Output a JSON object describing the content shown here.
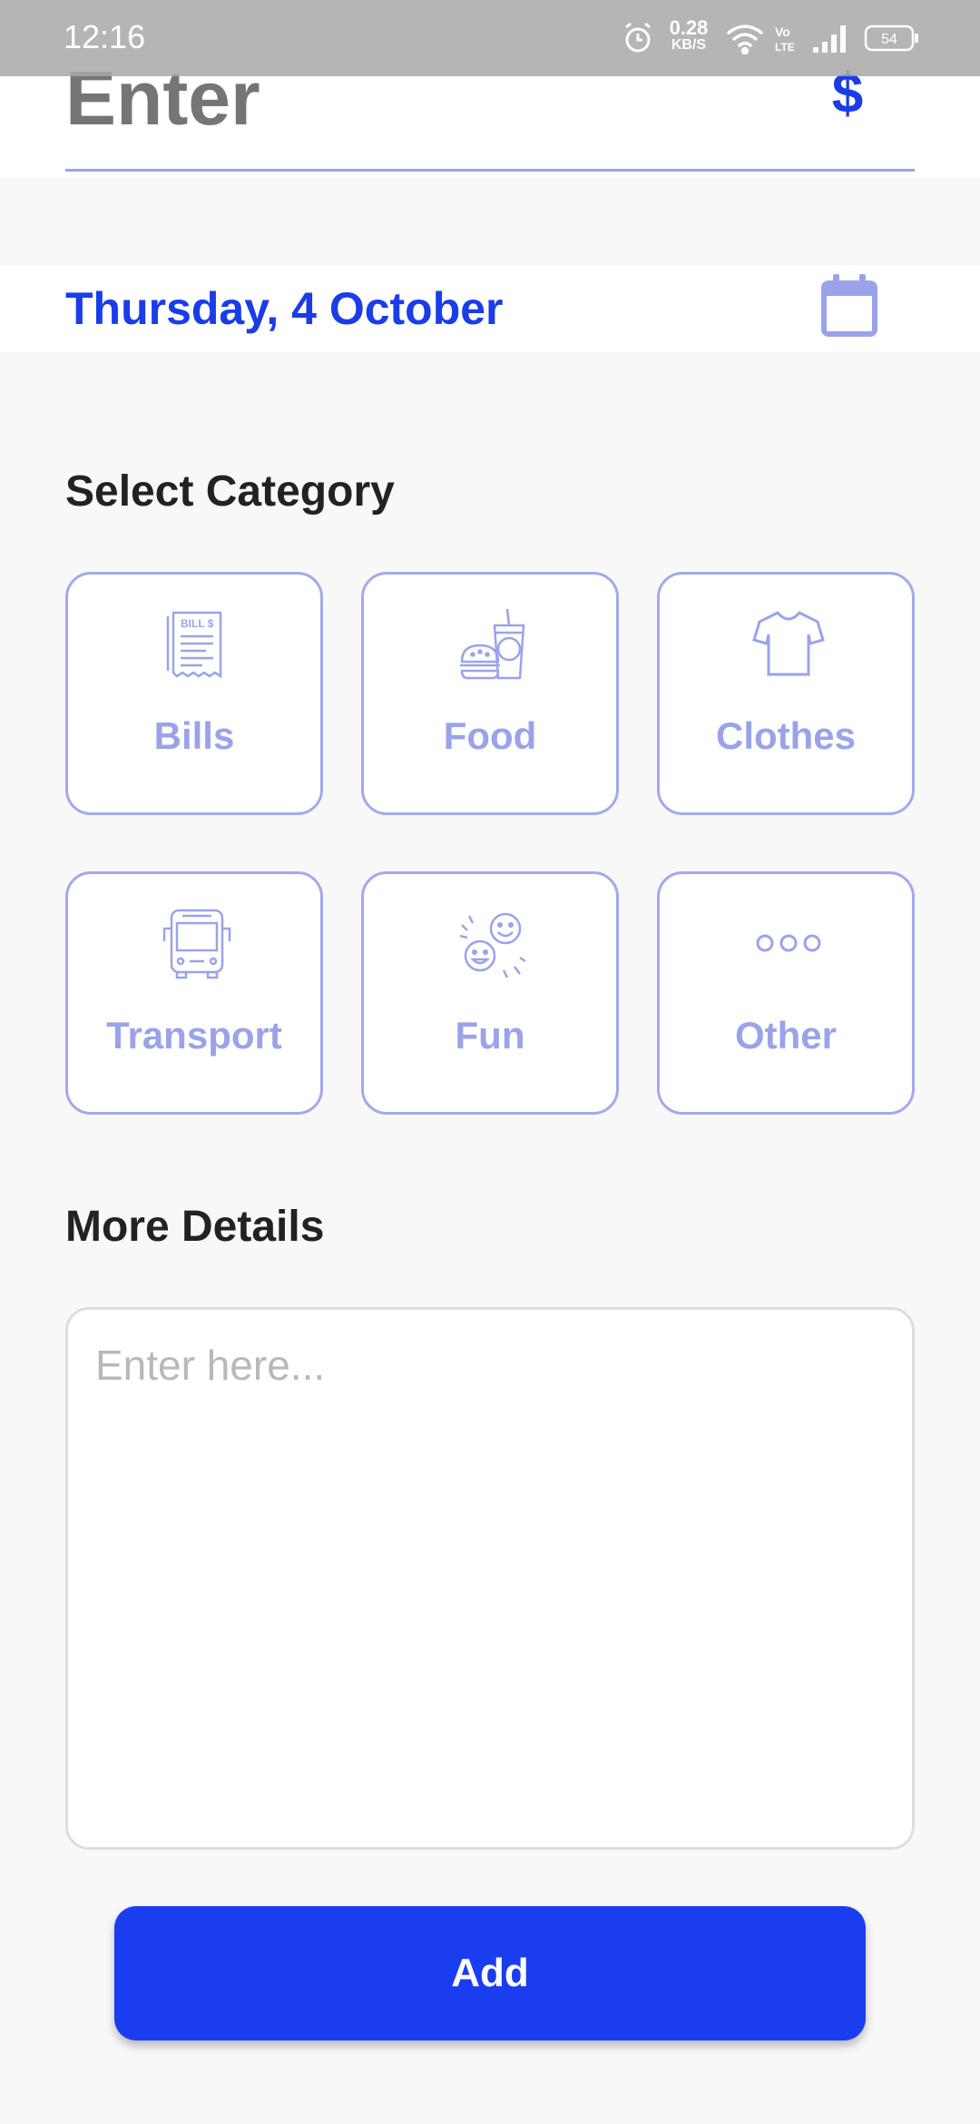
{
  "status_bar": {
    "time": "12:16",
    "net_speed_value": "0.28",
    "net_speed_unit": "KB/S",
    "battery": "54"
  },
  "amount": {
    "placeholder": "Enter",
    "currency_symbol": "$"
  },
  "date": {
    "label": "Thursday, 4 October"
  },
  "category_section": {
    "title": "Select Category",
    "items": [
      {
        "label": "Bills",
        "icon": "bill-icon"
      },
      {
        "label": "Food",
        "icon": "food-icon"
      },
      {
        "label": "Clothes",
        "icon": "shirt-icon"
      },
      {
        "label": "Transport",
        "icon": "bus-icon"
      },
      {
        "label": "Fun",
        "icon": "fun-faces-icon"
      },
      {
        "label": "Other",
        "icon": "more-dots-icon"
      }
    ],
    "bill_icon_text": "BILL $"
  },
  "details_section": {
    "title": "More Details",
    "placeholder": "Enter here..."
  },
  "actions": {
    "add_label": "Add"
  },
  "colors": {
    "accent": "#1a3de8",
    "accent_light": "#9aa3ea",
    "card_border": "#a2aaec",
    "background": "#f8f8f8",
    "button": "#1a3df0"
  }
}
